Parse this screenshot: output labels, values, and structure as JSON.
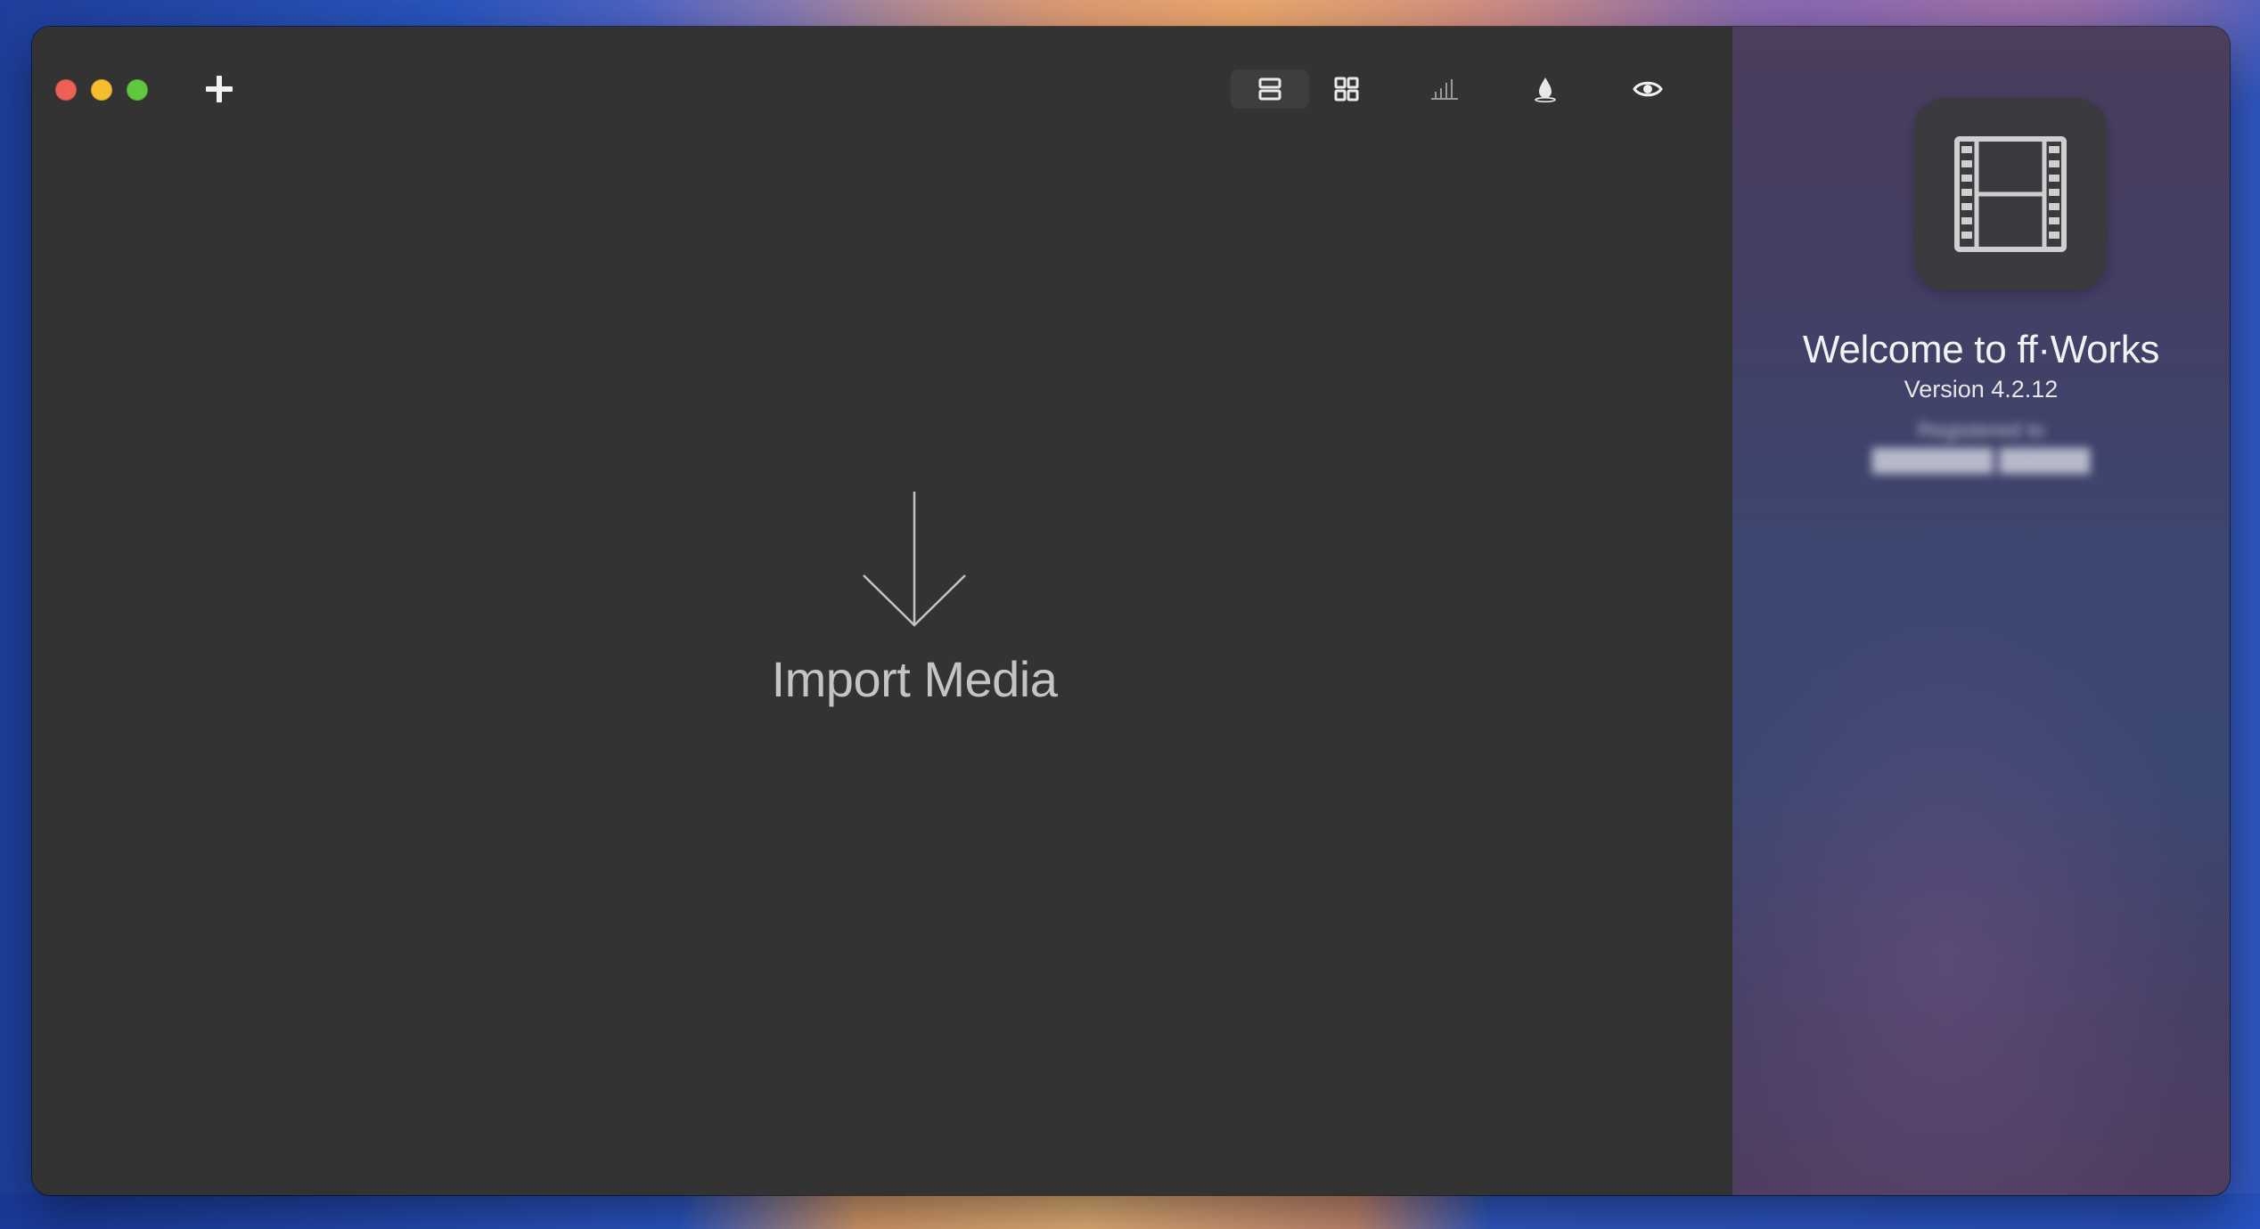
{
  "window": {
    "traffic_lights": [
      "close",
      "minimize",
      "zoom"
    ]
  },
  "toolbar": {
    "add_icon": "plus-icon",
    "buttons": [
      {
        "name": "list-view",
        "icon": "list-view-icon",
        "selected": true
      },
      {
        "name": "grid-view",
        "icon": "grid-view-icon",
        "selected": false
      },
      {
        "name": "audio-levels",
        "icon": "bar-chart-icon",
        "selected": false
      },
      {
        "name": "color",
        "icon": "drop-icon",
        "selected": false
      },
      {
        "name": "preview",
        "icon": "eye-icon",
        "selected": false
      }
    ]
  },
  "main": {
    "import_label": "Import Media",
    "import_icon": "arrow-down-icon"
  },
  "sidebar": {
    "app_icon": "film-strip-icon",
    "welcome_title": "Welcome to ff·Works",
    "version": "Version 4.2.12",
    "registered_to": "Registered to",
    "registered_name": "████████ ██████"
  },
  "colors": {
    "main_bg": "#333333",
    "close": "#ee5f57",
    "minimize": "#f5bd2f",
    "zoom": "#5fc83f"
  }
}
